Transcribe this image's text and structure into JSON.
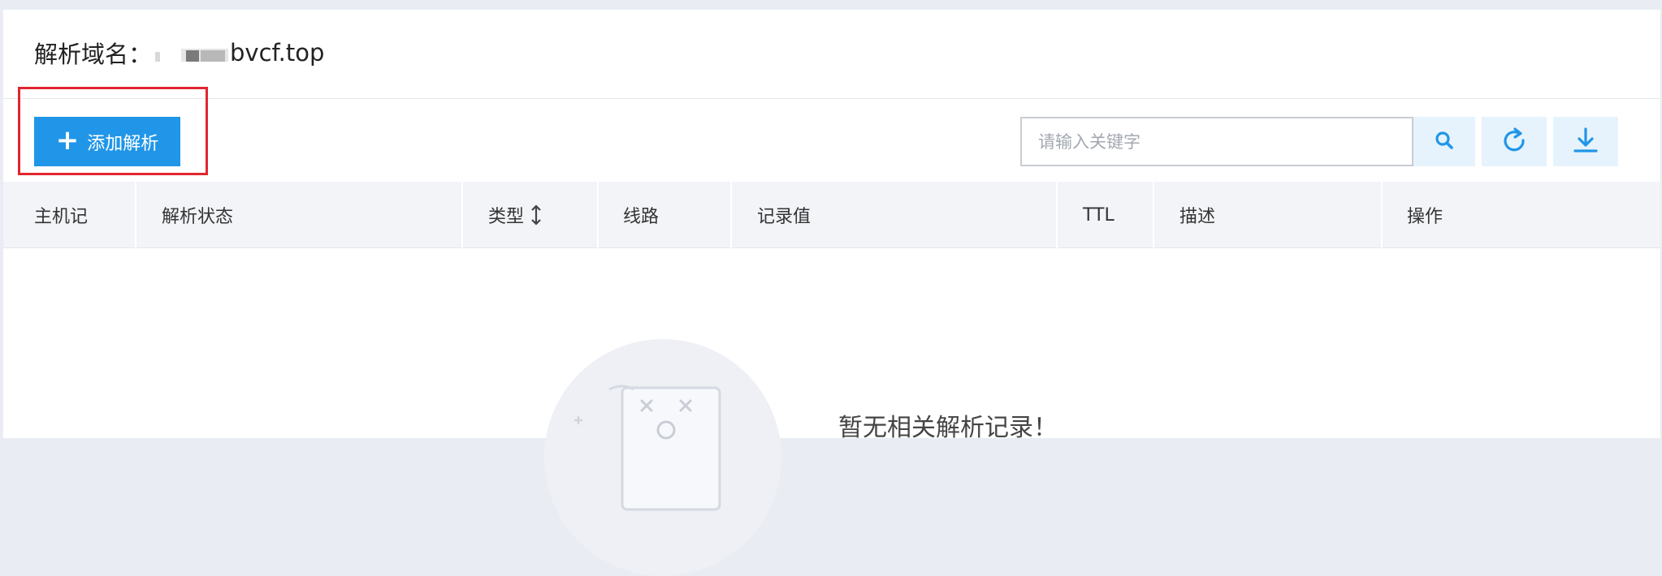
{
  "domain": {
    "label": "解析域名：",
    "value_suffix": "bvcf.top"
  },
  "toolbar": {
    "add_label": "添加解析",
    "search_placeholder": "请输入关键字"
  },
  "table": {
    "columns": [
      "主机记",
      "解析状态",
      "类型",
      "线路",
      "记录值",
      "TTL",
      "描述",
      "操作"
    ]
  },
  "empty": {
    "message": "暂无相关解析记录！"
  },
  "colors": {
    "primary": "#2196e8",
    "highlight": "#e1262f",
    "icon_button_bg": "#e6f3fd"
  }
}
